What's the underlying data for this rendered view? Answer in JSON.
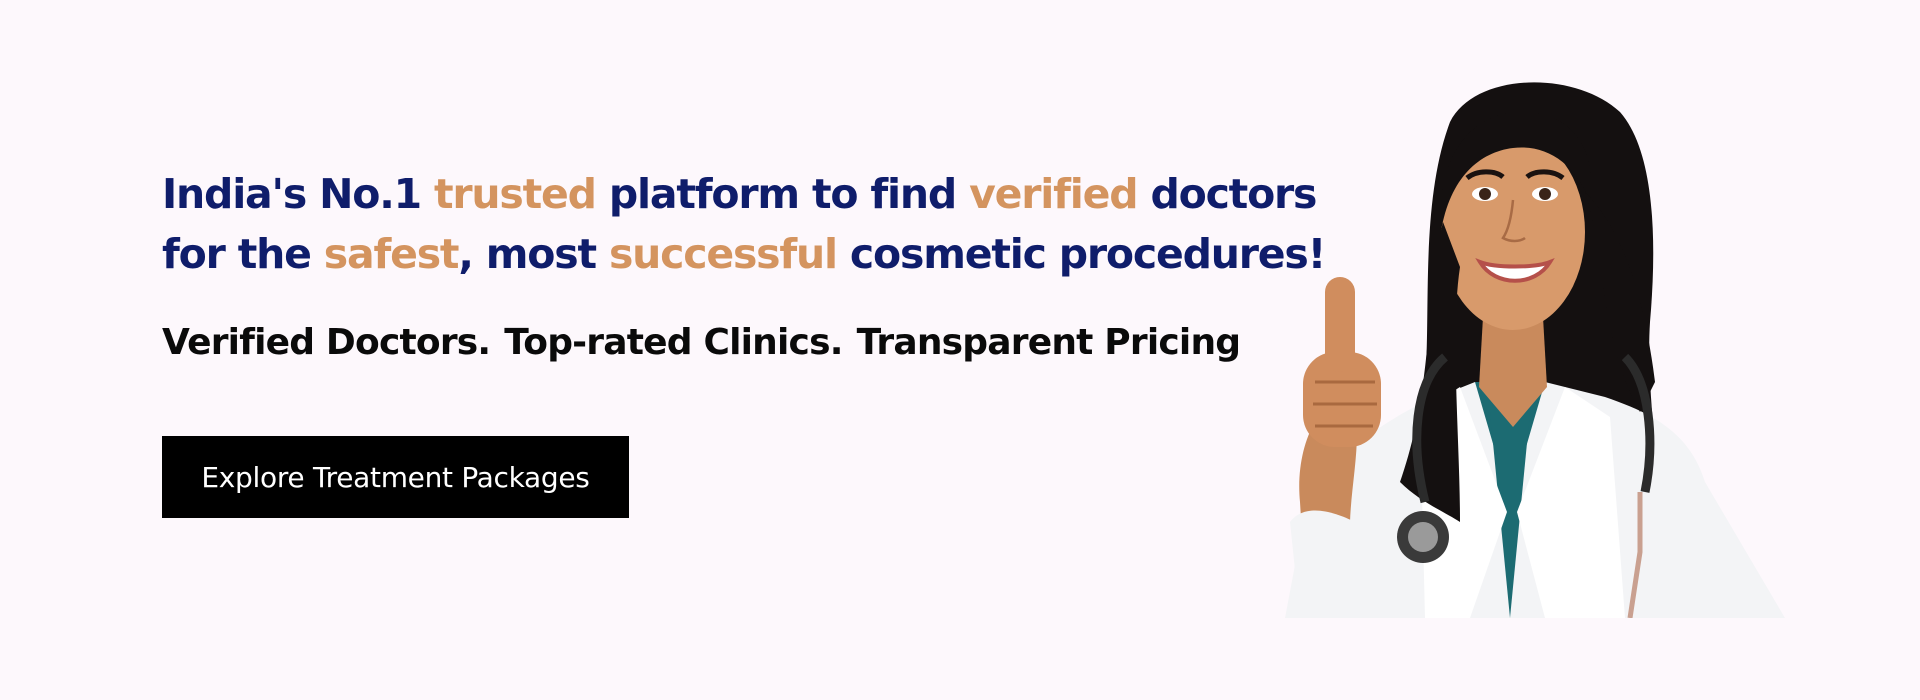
{
  "hero": {
    "headline": [
      {
        "text": "India's No.1 ",
        "highlight": false
      },
      {
        "text": "trusted",
        "highlight": true
      },
      {
        "text": " platform to find ",
        "highlight": false
      },
      {
        "text": "verified",
        "highlight": true
      },
      {
        "text": " doctors for the ",
        "highlight": false
      },
      {
        "text": "safest",
        "highlight": true
      },
      {
        "text": ", most ",
        "highlight": false
      },
      {
        "text": "successful",
        "highlight": true
      },
      {
        "text": " cosmetic procedures!",
        "highlight": false
      }
    ],
    "tagline": [
      "Verified Doctors.",
      "Top-rated Clinics.",
      "Transparent Pricing"
    ],
    "cta_label": "Explore Treatment Packages"
  },
  "colors": {
    "background": "#fdf8fc",
    "headline_primary": "#0f1d6b",
    "headline_highlight": "#d4945f",
    "cta_background": "#000000",
    "cta_text": "#ffffff"
  },
  "image": {
    "subject": "smiling-doctor-thumbs-up-with-stethoscope"
  }
}
